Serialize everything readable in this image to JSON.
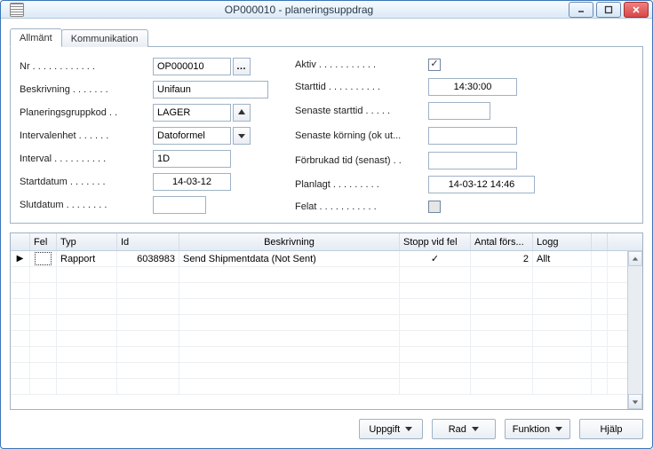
{
  "window": {
    "title": "OP000010 - planeringsuppdrag"
  },
  "tabs": [
    {
      "label": "Allmänt",
      "active": true
    },
    {
      "label": "Kommunikation",
      "active": false
    }
  ],
  "left_fields": {
    "nr": {
      "label": "Nr",
      "value": "OP000010"
    },
    "beskrivning": {
      "label": "Beskrivning",
      "value": "Unifaun"
    },
    "plankod": {
      "label": "Planeringsgruppkod",
      "value": "LAGER"
    },
    "intervalenhet": {
      "label": "Intervalenhet",
      "value": "Datoformel"
    },
    "interval": {
      "label": "Interval",
      "value": "1D"
    },
    "startdatum": {
      "label": "Startdatum",
      "value": "14-03-12"
    },
    "slutdatum": {
      "label": "Slutdatum",
      "value": ""
    }
  },
  "right_fields": {
    "aktiv": {
      "label": "Aktiv",
      "checked": true
    },
    "starttid": {
      "label": "Starttid",
      "value": "14:30:00"
    },
    "senstart": {
      "label": "Senaste starttid",
      "value": ""
    },
    "senkor": {
      "label": "Senaste körning (ok ut...",
      "value": ""
    },
    "forbrukad": {
      "label": "Förbrukad tid (senast)",
      "value": ""
    },
    "planlagt": {
      "label": "Planlagt",
      "value": "14-03-12 14:46"
    },
    "felat": {
      "label": "Felat",
      "checked": false
    }
  },
  "grid": {
    "columns": [
      "",
      "Fel",
      "Typ",
      "Id",
      "Beskrivning",
      "Stopp vid fel",
      "Antal förs...",
      "Logg"
    ],
    "rows": [
      {
        "fel": "",
        "typ": "Rapport",
        "id": "6038983",
        "beskr": "Send Shipmentdata (Not Sent)",
        "stopp": true,
        "antal": "2",
        "logg": "Allt"
      }
    ]
  },
  "buttons": {
    "uppgift": "Uppgift",
    "rad": "Rad",
    "funktion": "Funktion",
    "hjalp": "Hjälp"
  }
}
